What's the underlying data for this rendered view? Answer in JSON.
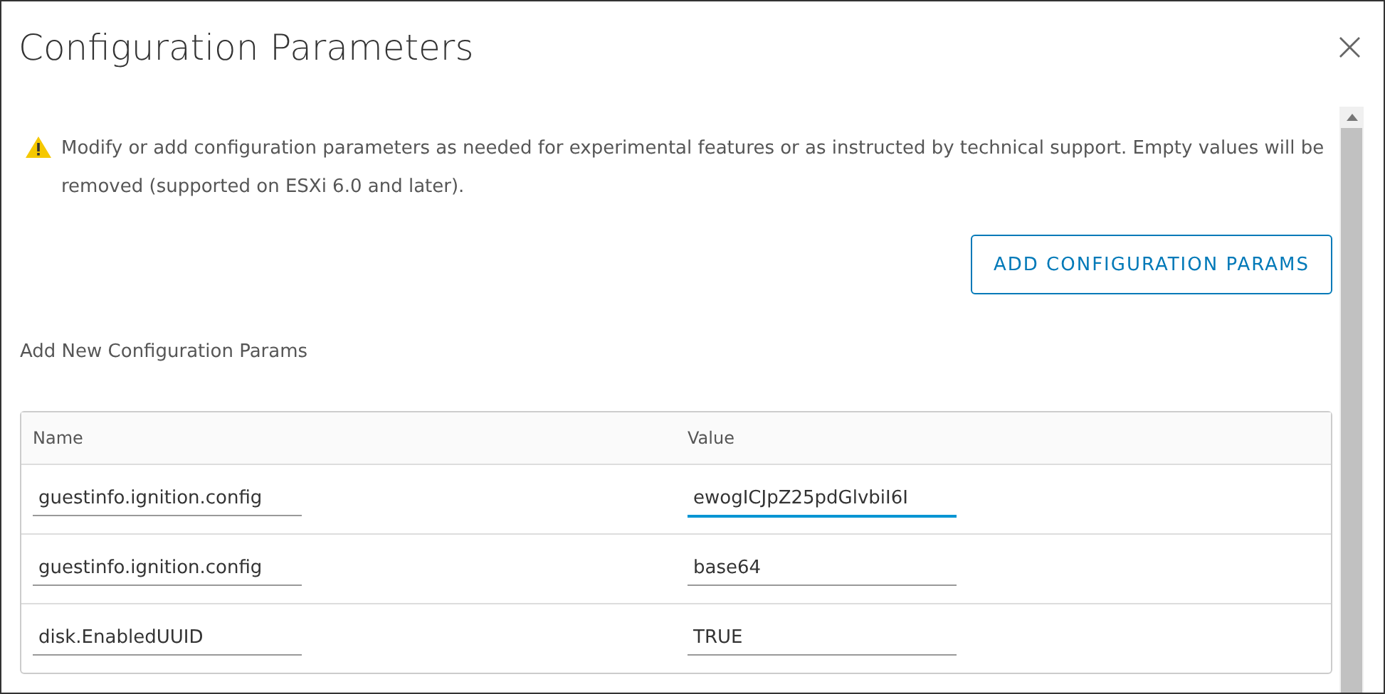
{
  "dialog": {
    "title": "Configuration Parameters",
    "close": "×"
  },
  "warning": "Modify or add configuration parameters as needed for experimental features or as instructed by technical support. Empty values will be removed (supported on ESXi 6.0 and later).",
  "add_button": "ADD CONFIGURATION PARAMS",
  "section_label": "Add New Configuration Params",
  "table": {
    "columns": [
      "Name",
      "Value"
    ],
    "rows": [
      {
        "name": "guestinfo.ignition.config",
        "value": "ewogICJpZ25pdGlvbiI6I",
        "focused": true
      },
      {
        "name": "guestinfo.ignition.config",
        "value": "base64",
        "focused": false
      },
      {
        "name": "disk.EnabledUUID",
        "value": "TRUE",
        "focused": false
      }
    ]
  }
}
